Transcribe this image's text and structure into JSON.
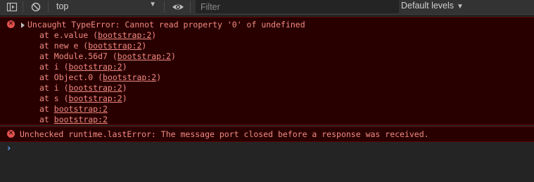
{
  "toolbar": {
    "context": "top",
    "filter_placeholder": "Filter",
    "levels_label": "Default levels"
  },
  "colors": {
    "error_bg": "#290000",
    "error_text": "#f28b82",
    "error_icon": "#e0514d",
    "prompt_accent": "#5d9df5"
  },
  "messages": [
    {
      "type": "error",
      "text": "Uncaught TypeError: Cannot read property '0' of undefined",
      "stack": [
        {
          "prefix": "at e.value (",
          "link": "bootstrap:2",
          "suffix": ")"
        },
        {
          "prefix": "at new e (",
          "link": "bootstrap:2",
          "suffix": ")"
        },
        {
          "prefix": "at Module.56d7 (",
          "link": "bootstrap:2",
          "suffix": ")"
        },
        {
          "prefix": "at i (",
          "link": "bootstrap:2",
          "suffix": ")"
        },
        {
          "prefix": "at Object.0 (",
          "link": "bootstrap:2",
          "suffix": ")"
        },
        {
          "prefix": "at i (",
          "link": "bootstrap:2",
          "suffix": ")"
        },
        {
          "prefix": "at s (",
          "link": "bootstrap:2",
          "suffix": ")"
        },
        {
          "prefix": "at ",
          "link": "bootstrap:2",
          "suffix": ""
        },
        {
          "prefix": "at ",
          "link": "bootstrap:2",
          "suffix": ""
        }
      ]
    },
    {
      "type": "error",
      "text": "Unchecked runtime.lastError: The message port closed before a response was received."
    }
  ],
  "prompt": {
    "symbol": "›",
    "value": ""
  }
}
